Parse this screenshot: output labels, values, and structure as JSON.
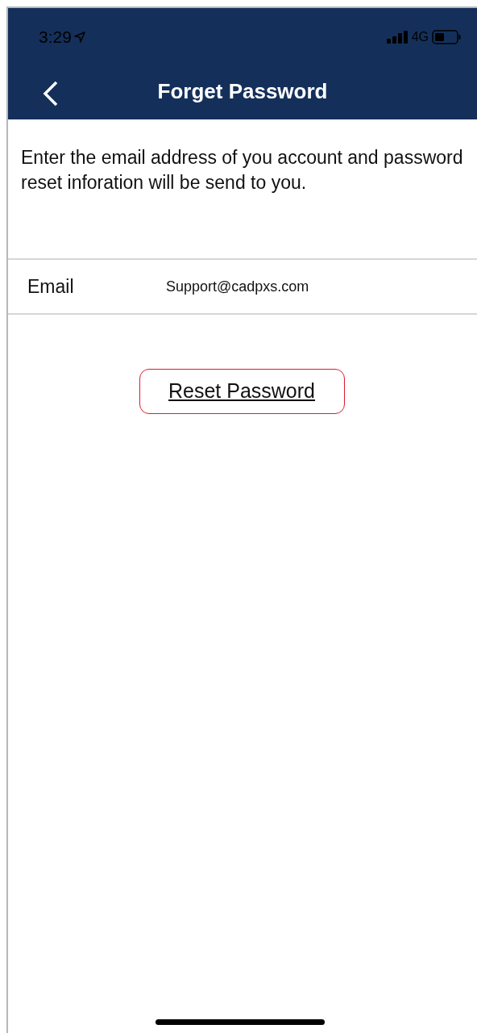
{
  "status_bar": {
    "time": "3:29",
    "network": "4G"
  },
  "nav": {
    "title": "Forget Password"
  },
  "instructions": "Enter the email address of you account and password reset inforation will be send to you.",
  "email_field": {
    "label": "Email",
    "value": "Support@cadpxs.com"
  },
  "reset_button": {
    "label": "Reset Password"
  }
}
